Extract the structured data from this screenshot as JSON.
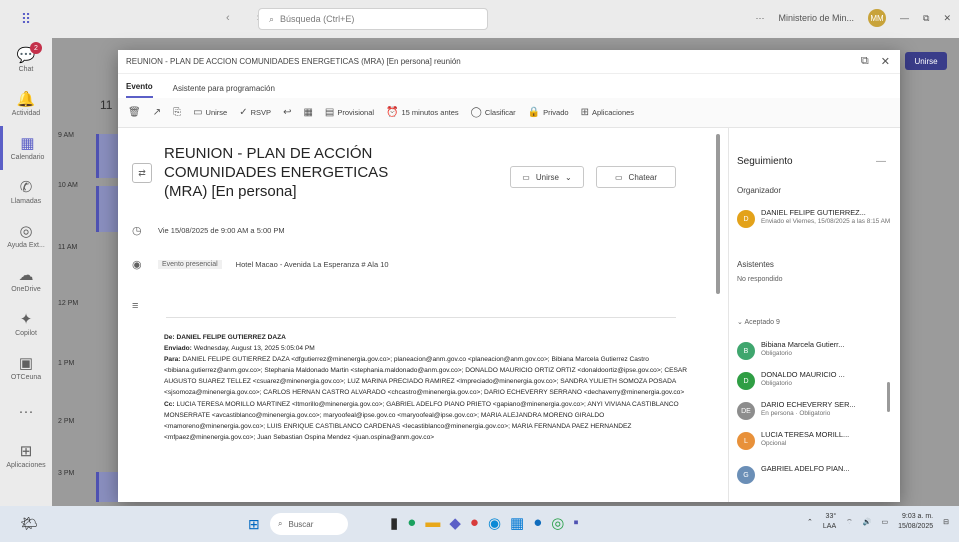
{
  "topbar": {
    "search_placeholder": "Búsqueda (Ctrl+E)",
    "profile_label": "Ministerio de Min...",
    "nav_arrows": "‹ ›",
    "minimize": "—",
    "restore": "⧉",
    "close": "✕"
  },
  "rail": {
    "items": [
      {
        "label": "Chat",
        "icon": "chat-icon",
        "glyph": "💬",
        "badge": "2"
      },
      {
        "label": "Actividad",
        "icon": "bell-icon",
        "glyph": "🔔"
      },
      {
        "label": "Calendario",
        "icon": "calendar-icon",
        "glyph": "▦"
      },
      {
        "label": "Llamadas",
        "icon": "phone-icon",
        "glyph": "✆"
      },
      {
        "label": "Ayuda Ext...",
        "icon": "help-icon",
        "glyph": "◎"
      },
      {
        "label": "OneDrive",
        "icon": "cloud-icon",
        "glyph": "☁"
      },
      {
        "label": "Copilot",
        "icon": "copilot-icon",
        "glyph": "✦"
      },
      {
        "label": "OTCeuna",
        "icon": "app-icon",
        "glyph": "▣"
      },
      {
        "label": "...",
        "icon": "more-icon",
        "glyph": "···"
      },
      {
        "label": "Aplicaciones",
        "icon": "apps-icon",
        "glyph": "⊞"
      }
    ]
  },
  "calendar": {
    "times": [
      "9 AM",
      "10 AM",
      "11 AM",
      "12 PM",
      "1 PM",
      "2 PM",
      "3 PM"
    ],
    "day_label": "11",
    "join_label": "Unirse"
  },
  "modal": {
    "window_title": "REUNION - PLAN DE ACCION COMUNIDADES ENERGETICAS (MRA) [En persona] reunión",
    "tabs": [
      "Evento",
      "Asistente para programación"
    ],
    "ribbon": [
      {
        "icon": "delete-icon",
        "glyph": "🗑",
        "label": ""
      },
      {
        "icon": "forward-icon",
        "glyph": "↗",
        "label": ""
      },
      {
        "icon": "copy-icon",
        "glyph": "⎘",
        "label": ""
      },
      {
        "icon": "video-icon",
        "glyph": "▭",
        "label": "Unirse"
      },
      {
        "icon": "rsvp-icon",
        "glyph": "✓",
        "label": "RSVP"
      },
      {
        "icon": "reply-icon",
        "glyph": "↩",
        "label": ""
      },
      {
        "icon": "grid-icon",
        "glyph": "▦",
        "label": ""
      },
      {
        "icon": "status-icon",
        "glyph": "▤",
        "label": "Provisional"
      },
      {
        "icon": "reminder-icon",
        "glyph": "⏰",
        "label": "15 minutos antes"
      },
      {
        "icon": "categorize-icon",
        "glyph": "◯",
        "label": "Clasificar"
      },
      {
        "icon": "private-icon",
        "glyph": "🔒",
        "label": "Privado"
      },
      {
        "icon": "apps-icon",
        "glyph": "⊞",
        "label": "Aplicaciones"
      }
    ],
    "restore": "⧉",
    "close": "✕"
  },
  "event": {
    "title": "REUNION - PLAN DE ACCIÓN COMUNIDADES ENERGETICAS (MRA) [En persona]",
    "join_btn": "Unirse",
    "chat_btn": "Chatear",
    "datetime": "Vie 15/08/2025 de 9:00 AM a 5:00 PM",
    "location_tag": "Evento presencial",
    "location": "Hotel Macao - Avenida La Esperanza # Ala 10",
    "email": {
      "from_label": "De:",
      "from": "DANIEL FELIPE GUTIERREZ DAZA",
      "sent_label": "Enviado:",
      "sent": "Wednesday, August 13, 2025 5:05:04 PM",
      "to_label": "Para:",
      "to": "DANIEL FELIPE GUTIERREZ DAZA <dfgutierrez@minenergia.gov.co>; planeacion@anm.gov.co <planeacion@anm.gov.co>; Bibiana Marcela Gutierrez Castro <bibiana.gutierrez@anm.gov.co>; Stephania Maldonado Martin <stephania.maldonado@anm.gov.co>; DONALDO MAURICIO ORTIZ ORTIZ <donaldoortiz@ipse.gov.co>; CESAR AUGUSTO SUAREZ TELLEZ <csuarez@minenergia.gov.co>; LUZ MARINA PRECIADO RAMIREZ <lmpreciado@minenergia.gov.co>; SANDRA YULIETH SOMOZA POSADA <sjsomoza@minenergia.gov.co>; CARLOS HERNAN CASTRO ALVARADO <chcastro@minenergia.gov.co>; DARIO ECHEVERRY SERRANO <dechaverry@minenergia.gov.co>",
      "cc_label": "Cc:",
      "cc": "LUCIA TERESA MORILLO MARTINEZ <ltmorillo@minenergia.gov.co>; GABRIEL ADELFO PIANO PRIETO <gapiano@minenergia.gov.co>; ANYI VIVIANA CASTIBLANCO MONSERRATE <avcastiblanco@minenergia.gov.co>; maryoofeal@ipse.gov.co <maryoofeal@ipse.gov.co>; MARIA ALEJANDRA MORENO GIRALDO <mamoreno@minenergia.gov.co>; LUIS ENRIQUE CASTIBLANCO CARDENAS <lecastiblanco@minenergia.gov.co>; MARIA FERNANDA PAEZ HERNANDEZ <mfpaez@minenergia.gov.co>; Juan Sebastian Ospina Mendez <juan.ospina@anm.gov.co>"
    }
  },
  "tracking": {
    "heading": "Seguimiento",
    "organizer_label": "Organizador",
    "organizer": {
      "name": "DANIEL FELIPE GUTIERREZ...",
      "initials": "D",
      "status": "Enviado el Viernes, 15/08/2025 a las 8:15 AM",
      "color": "#e3a21a"
    },
    "attendees_label": "Asistentes",
    "attendees_note": "No respondido",
    "group_label": "Aceptado 9",
    "people": [
      {
        "name": "Bibiana Marcela Gutierr...",
        "initials": "B",
        "status": "Obligatorio",
        "color": "#3fa66e"
      },
      {
        "name": "DONALDO MAURICIO ...",
        "initials": "D",
        "status": "Obligatorio",
        "color": "#2f9e44"
      },
      {
        "name": "DARIO ECHEVERRY SER...",
        "initials": "DE",
        "status": "En persona · Obligatorio",
        "color": "#8d8d8d"
      },
      {
        "name": "LUCIA TERESA MORILL...",
        "initials": "L",
        "status": "Opcional",
        "color": "#e8913a"
      },
      {
        "name": "GABRIEL ADELFO PIAN...",
        "initials": "G",
        "status": "",
        "color": "#6b8fb7"
      }
    ]
  },
  "taskbar": {
    "search": "Buscar",
    "weather_temp": "33°",
    "weather_desc": "LAA",
    "time": "9:03 a. m.",
    "date": "15/08/2025",
    "apps": [
      "▮",
      "●",
      "▬",
      "◆",
      "●",
      "◉",
      "▦",
      "●",
      "◎",
      "▪"
    ]
  }
}
